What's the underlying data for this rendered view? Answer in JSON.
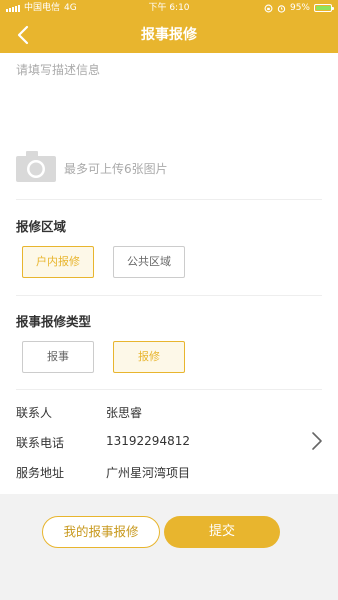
{
  "status_bar": {
    "carrier": "中国电信",
    "network": "4G",
    "time": "下午 6:10",
    "battery_percent": "95%",
    "battery_level": 0.95
  },
  "header": {
    "title": "报事报修",
    "back_icon": "chevron-left-icon"
  },
  "form": {
    "description_placeholder": "请填写描述信息",
    "description_value": "",
    "upload_hint": "最多可上传6张图片",
    "area_section": {
      "title": "报修区域",
      "options": [
        "户内报修",
        "公共区域"
      ],
      "selected": "户内报修"
    },
    "type_section": {
      "title": "报事报修类型",
      "options": [
        "报事",
        "报修"
      ],
      "selected": "报修"
    },
    "contact": {
      "name_label": "联系人",
      "name_value": "张思睿",
      "phone_label": "联系电话",
      "phone_value": "13192294812",
      "address_label": "服务地址",
      "address_value": "广州星河湾项目"
    }
  },
  "footer": {
    "my_reports_label": "我的报事报修",
    "submit_label": "提交"
  },
  "colors": {
    "accent": "#e8b52e",
    "background": "#f2f2f2",
    "selected_bg": "#fdf8e8"
  }
}
